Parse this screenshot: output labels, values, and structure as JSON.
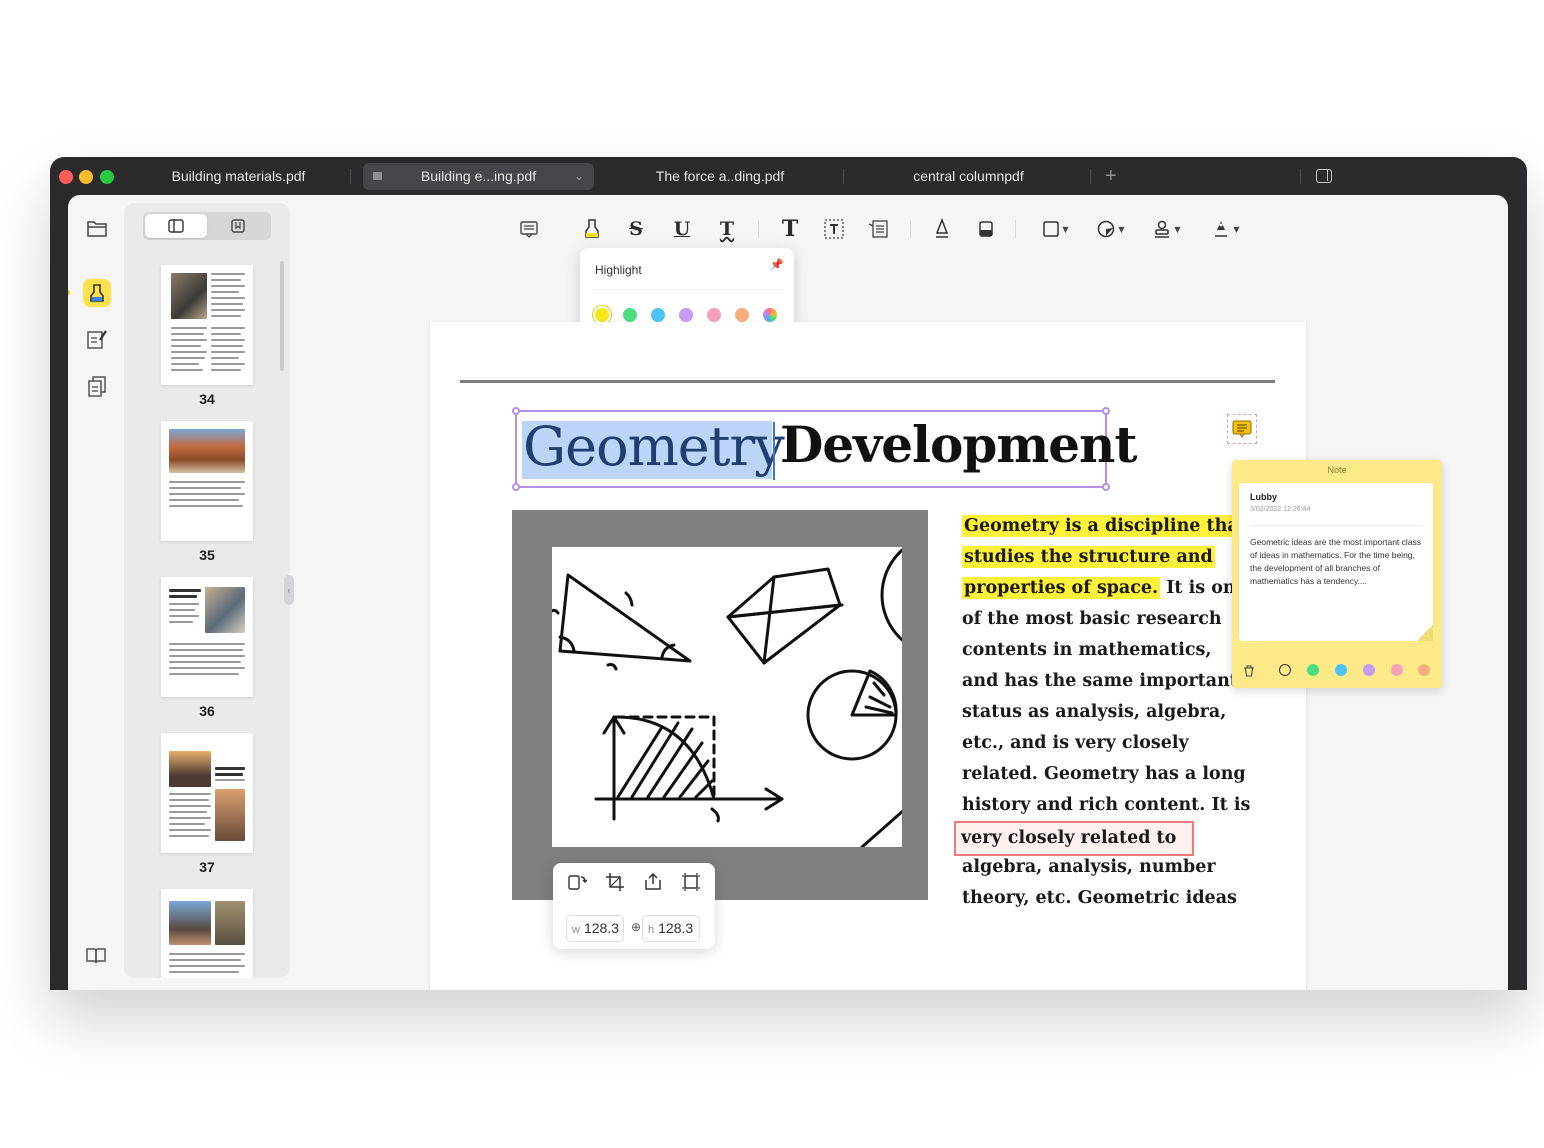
{
  "tabs": [
    {
      "label": "Building materials.pdf"
    },
    {
      "label": "Building e...ing.pdf"
    },
    {
      "label": "The force a..ding.pdf"
    },
    {
      "label": "central columnpdf"
    }
  ],
  "thumbnails": [
    {
      "page": "34"
    },
    {
      "page": "35"
    },
    {
      "page": "36"
    },
    {
      "page": "37"
    }
  ],
  "highlight_popover": {
    "title": "Highlight",
    "colors": [
      "#f5e71c",
      "#4ade80",
      "#4cc3f5",
      "#c79bf2",
      "#f7a0bd",
      "#f8ad7e"
    ]
  },
  "document": {
    "title_part1": "Geometry",
    "title_part2": "Development",
    "body_lines": [
      "Geometry is a discipline that",
      "studies the structure and",
      "properties of space.",
      " It is one",
      "of the most basic research",
      "contents in mathematics,",
      "and has the same important",
      "status as analysis, algebra,",
      "etc., and is very closely",
      "related. Geometry has a long",
      "history and rich content. It is",
      "very closely related to",
      "algebra, analysis, number",
      "theory, etc. Geometric ideas"
    ]
  },
  "note": {
    "header": "Note",
    "author": "Lubby",
    "date": "3/02/2022 12:26:44",
    "body": "Geometric ideas are the most important class of ideas in mathematics. For the time being, the development of all branches of mathematics has a tendency....",
    "colors": [
      "#4ade80",
      "#4cc3f5",
      "#c79bf2",
      "#f7a0bd",
      "#f8ad7e"
    ]
  },
  "image_tools": {
    "w_label": "w",
    "w_value": "128.3",
    "h_label": "h",
    "h_value": "128.3"
  }
}
